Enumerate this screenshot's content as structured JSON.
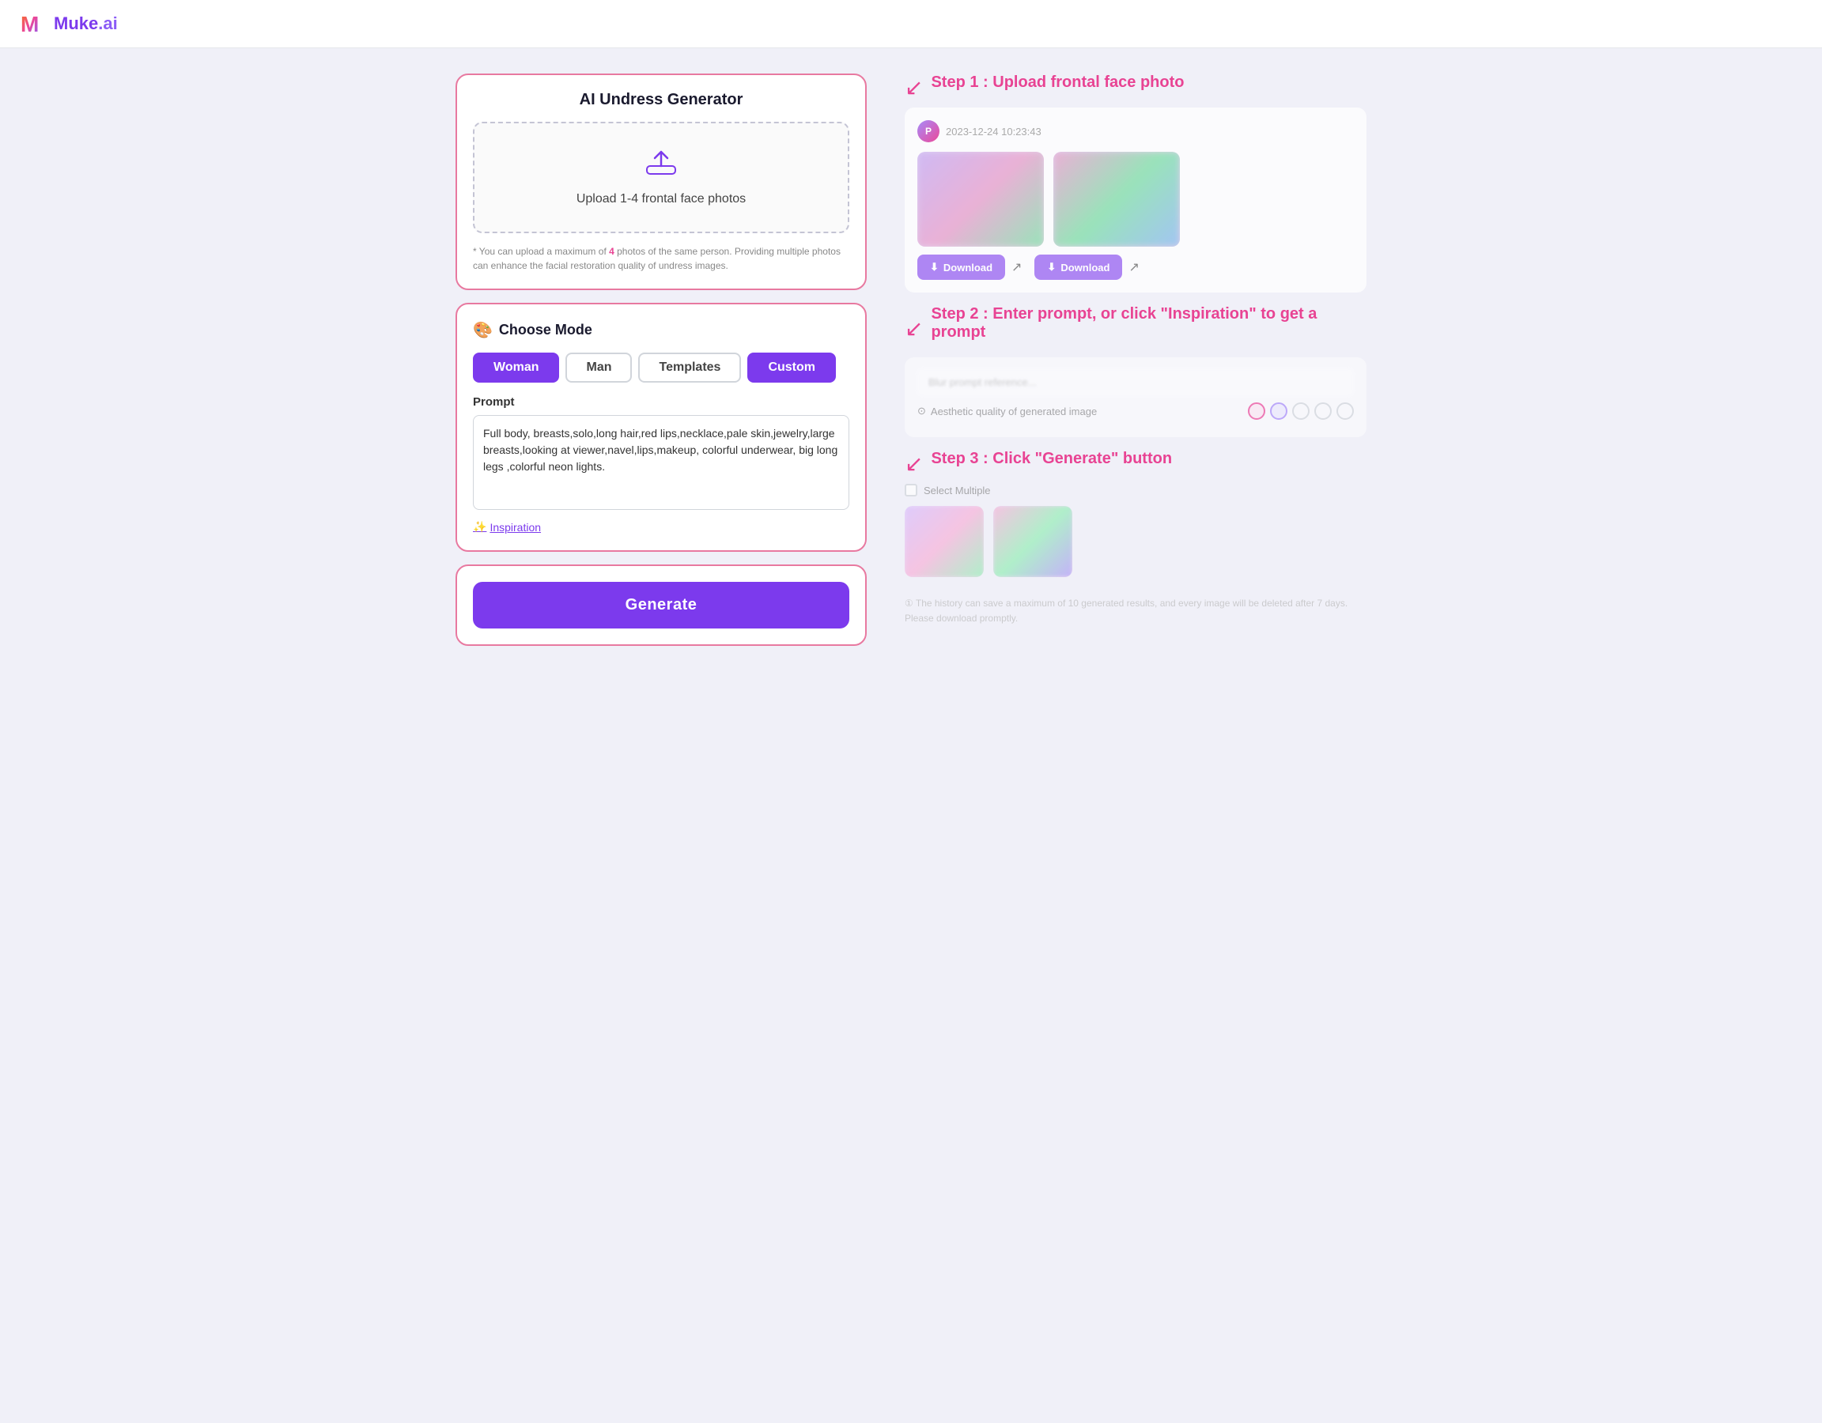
{
  "header": {
    "logo_text": "Muke",
    "logo_accent": ".ai"
  },
  "upload_card": {
    "title": "AI Undress Generator",
    "upload_text": "Upload 1-4 frontal face photos",
    "upload_note": "* You can upload a maximum of 4 photos of the same person. Providing multiple photos can enhance the facial restoration quality of undress images.",
    "highlight_number": "4"
  },
  "mode_card": {
    "title": "Choose Mode",
    "buttons": [
      {
        "label": "Woman",
        "state": "active"
      },
      {
        "label": "Man",
        "state": "inactive"
      },
      {
        "label": "Templates",
        "state": "inactive"
      },
      {
        "label": "Custom",
        "state": "active"
      }
    ],
    "prompt_label": "Prompt",
    "prompt_text": "Full body, breasts,solo,long hair,red lips,necklace,pale skin,jewelry,large breasts,looking at viewer,navel,lips,makeup, colorful underwear, big long legs ,colorful neon lights.",
    "inspiration_label": "Inspiration"
  },
  "generate_card": {
    "button_label": "Generate"
  },
  "steps": [
    {
      "label": "Step 1 : Upload frontal face photo",
      "timestamp": "2023-12-24 10:23:43"
    },
    {
      "label": "Step 2 : Enter prompt, or click \"Inspiration\" to get a prompt"
    },
    {
      "label": "Step 3 : Click \"Generate\" button"
    }
  ],
  "quality": {
    "label": "Aesthetic quality of generated image"
  },
  "select_multiple": {
    "label": "Select Multiple"
  },
  "footer_note": "① The history can save a maximum of 10 generated results, and every image will be deleted after 7 days. Please download promptly."
}
